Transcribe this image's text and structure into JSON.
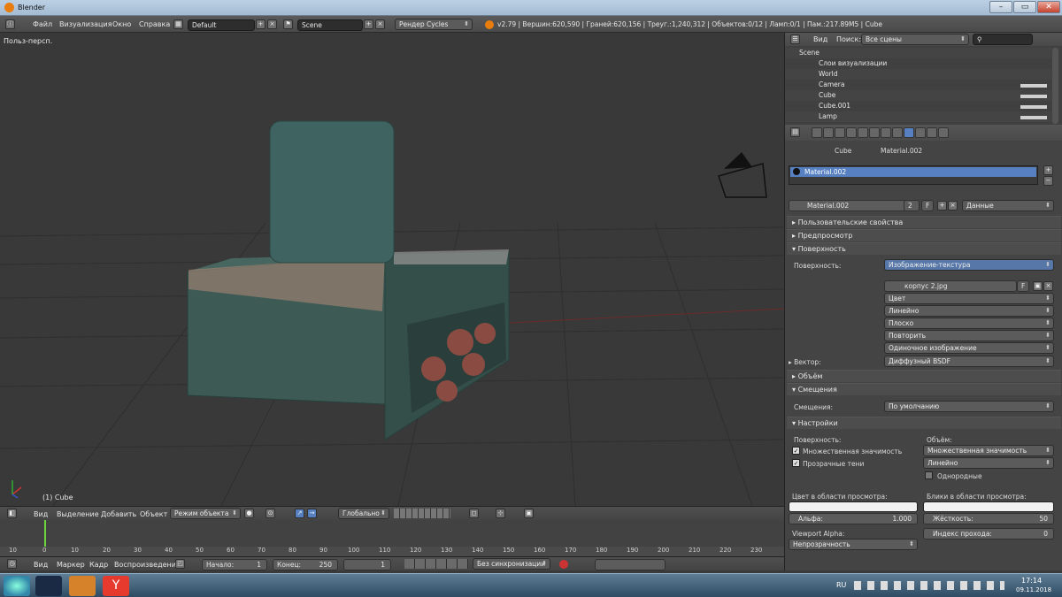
{
  "window": {
    "title": "Blender",
    "min_label": "–",
    "max_label": "▭",
    "close_label": "✕"
  },
  "topbar": {
    "menus": [
      "Файл",
      "Визуализация",
      "Окно",
      "Справка"
    ],
    "layout": "Default",
    "scene": "Scene",
    "engine": "Рендер Cycles",
    "stats": "v2.79 | Вершин:620,590 | Граней:620,156 | Треуг.:1,240,312 | Объектов:0/12 | Ламп:0/1 | Пам.:217.89M5 | Cube"
  },
  "viewport": {
    "view_label": "Польз-персп.",
    "object_label": "(1) Cube"
  },
  "viewport_header": {
    "menus": [
      "Вид",
      "Выделение",
      "Добавить",
      "Объект"
    ],
    "mode": "Режим объекта",
    "pivot": "Глобально"
  },
  "timeline": {
    "ticks": [
      "10",
      "0",
      "10",
      "20",
      "30",
      "40",
      "50",
      "60",
      "70",
      "80",
      "90",
      "100",
      "110",
      "120",
      "130",
      "140",
      "150",
      "160",
      "170",
      "180",
      "190",
      "200",
      "210",
      "220",
      "230"
    ],
    "current_frame": "1"
  },
  "timeline_header": {
    "menus": [
      "Вид",
      "Маркер",
      "Кадр",
      "Воспроизведение"
    ],
    "start": "Начало:",
    "start_val": "1",
    "end": "Конец:",
    "end_val": "250",
    "frame": "1",
    "sync": "Без синхронизации"
  },
  "outliner": {
    "menu_view": "Вид",
    "search_label": "Поиск:",
    "filter": "Все сцены",
    "rows": [
      "Scene",
      "Слои визуализации",
      "World",
      "Camera",
      "Cube",
      "Cube.001",
      "Lamp"
    ]
  },
  "properties": {
    "breadcrumb_obj": "Cube",
    "breadcrumb_mat": "Material.002",
    "slot": "Material.002",
    "mat_name": "Material.002",
    "users": "2",
    "fake": "F",
    "link": "Данные",
    "panels": {
      "custom": "Пользовательские свойства",
      "preview": "Предпросмотр",
      "surface": "Поверхность",
      "volume": "Объём",
      "displacement": "Смещения",
      "settings": "Настройки"
    },
    "surface_label": "Поверхность:",
    "surface_val": "Изображение-текстура",
    "image": "корпус 2.jpg",
    "image_f": "F",
    "tex_opts": [
      "Цвет",
      "Линейно",
      "Плоско",
      "Повторить",
      "Одиночное изображение"
    ],
    "vector_label": "Вектор:",
    "vector_val": "Диффузный BSDF",
    "disp_label": "Смещения:",
    "disp_val": "По умолчанию",
    "set_surface": "Поверхность:",
    "set_volume": "Объём:",
    "multi_imp": "Множественная значимость",
    "transp_shadows": "Прозрачные тени",
    "vol_sampling": "Множественная значимость",
    "vol_interp": "Линейно",
    "homogeneous": "Однородные",
    "vp_color": "Цвет в области просмотра:",
    "vp_spec": "Блики в области просмотра:",
    "alpha": "Альфа:",
    "alpha_val": "1.000",
    "hardness": "Жёсткость:",
    "hardness_val": "50",
    "vp_alpha": "Viewport Alpha:",
    "pass_index": "Индекс прохода:",
    "pass_val": "0",
    "blend": "Непрозрачность"
  },
  "taskbar": {
    "lang": "RU",
    "time": "17:14",
    "date": "09.11.2018"
  },
  "colors": {
    "accent": "#5680c2",
    "orange": "#e87d0d",
    "bg": "#393939"
  }
}
